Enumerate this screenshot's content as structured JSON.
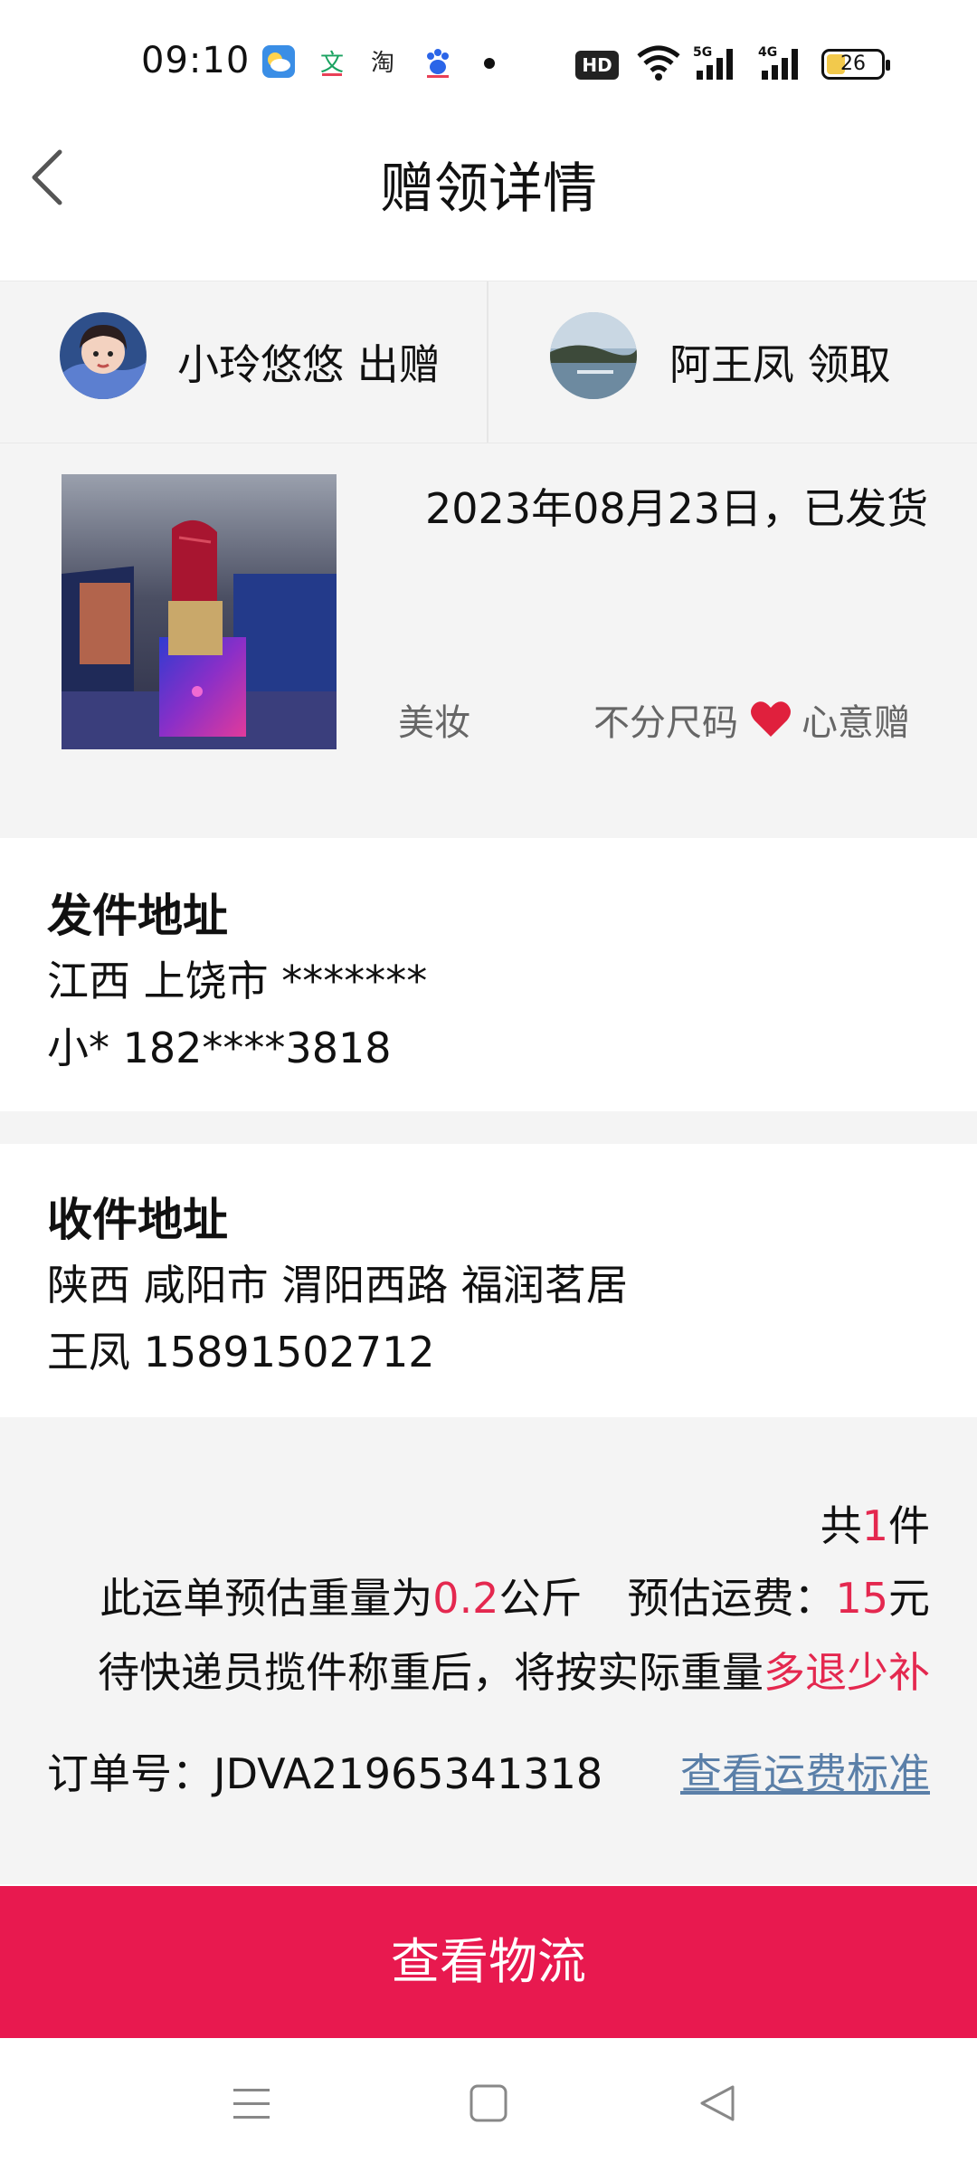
{
  "status_bar": {
    "time": "09:10",
    "hd_label": "HD",
    "battery_level": "26",
    "network": [
      "5G",
      "4G"
    ]
  },
  "header": {
    "title": "赠领详情"
  },
  "giver": {
    "name": "小玲悠悠",
    "action": "出赠"
  },
  "receiver": {
    "name": "阿王凤",
    "action": "领取"
  },
  "product": {
    "date_status": "2023年08月23日，已发货",
    "category": "美妆",
    "size": "不分尺码",
    "gift_type": "心意赠",
    "image": "lipstick-photo"
  },
  "sender_address": {
    "heading": "发件地址",
    "line1": "江西 上饶市 *******",
    "line2": "小* 182****3818"
  },
  "receiver_address": {
    "heading": "收件地址",
    "line1": "陕西 咸阳市 渭阳西路 福润茗居",
    "line2": "王凤 15891502712"
  },
  "summary": {
    "count_prefix": "共",
    "count_value": "1",
    "count_suffix": "件",
    "weight_prefix": "此运单预估重量为",
    "weight_value": "0.2",
    "weight_unit": "公斤",
    "fee_prefix": "预估运费：",
    "fee_value": "15",
    "fee_unit": "元",
    "note_prefix": "待快递员揽件称重后，将按实际重量",
    "note_highlight": "多退少补",
    "order_label": "订单号：",
    "order_number": "JDVA21965341318",
    "fee_standard_link": "查看运费标准"
  },
  "actions": {
    "view_logistics": "查看物流"
  },
  "colors": {
    "accent": "#e8194f",
    "highlight_text": "#e4284f",
    "link": "#5a7fa8",
    "panel_bg": "#f4f4f4"
  }
}
